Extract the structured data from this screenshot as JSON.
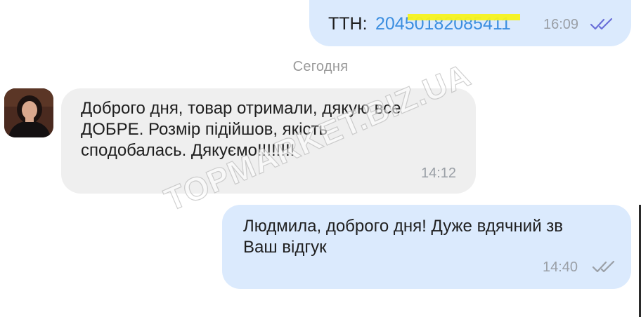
{
  "messages": [
    {
      "id": "ttn",
      "direction": "out",
      "label": "ТТН:",
      "tracking_number": "20450182085411",
      "time": "16:09",
      "status_icon": "double-check-read-icon"
    },
    {
      "id": "incoming",
      "direction": "in",
      "text": "Доброго дня,  товар отримали, дякую все\nДОБРЕ.  Розмір підійшов, якість\nсподобалась. Дякуємо!!!!!!!!",
      "time": "14:12"
    },
    {
      "id": "reply",
      "direction": "out",
      "text": "Людмила, доброго дня! Дуже вдячний зв\nВаш відгук",
      "time": "14:40",
      "status_icon": "double-check-read-icon"
    }
  ],
  "date_separator": "Сегодня",
  "avatar_icon": "user-avatar-icon",
  "watermark": "TOPMARKET.BIZ.UA",
  "colors": {
    "outgoing_bubble": "#dbeafd",
    "incoming_bubble": "#efefef",
    "link_blue": "#3b8ee0",
    "highlight_yellow": "#f7f31e",
    "check_read": "#6a6fd8",
    "check_grey": "#9a9fa6"
  }
}
